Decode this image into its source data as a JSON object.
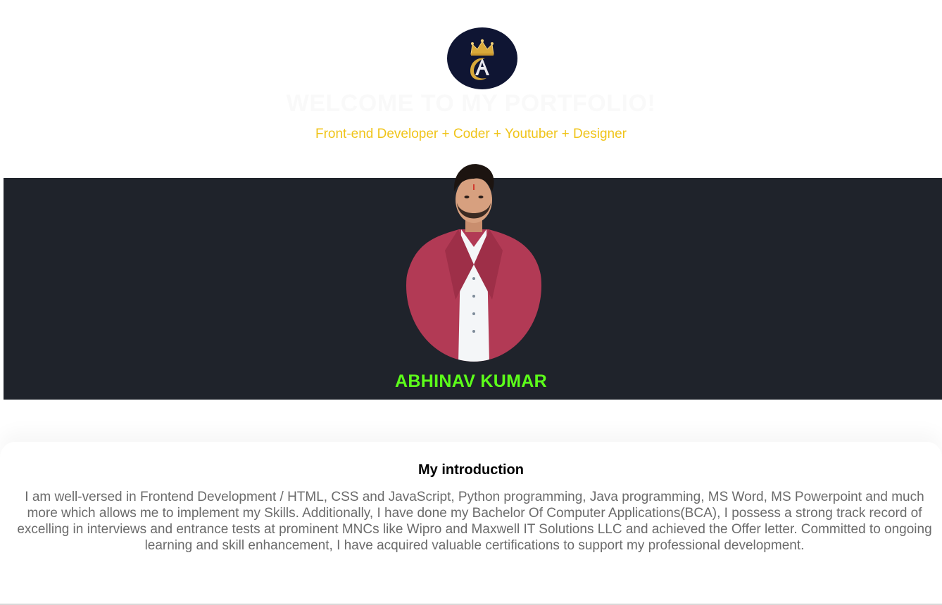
{
  "header": {
    "logo_icon": "crown-letter-a-logo",
    "logo_bg": "#0f1533",
    "welcome": "WELCOME TO MY PORTFOLIO!",
    "subtitle": "Front-end Developer + Coder + Youtuber + Designer",
    "subtitle_color": "#f0c419"
  },
  "hero": {
    "background": "#1f232b",
    "photo": "profile-photo",
    "name": "ABHINAV KUMAR",
    "name_color": "#5cff1a"
  },
  "intro": {
    "title": "My introduction",
    "body": "I am well-versed in Frontend Development / HTML, CSS and JavaScript, Python programming, Java programming, MS Word, MS Powerpoint and much more which allows me to implement my Skills. Additionally, I have done my Bachelor Of Computer Applications(BCA), I possess a strong track record of excelling in interviews and entrance tests at prominent MNCs like Wipro and Maxwell IT Solutions LLC and achieved the Offer letter. Committed to ongoing learning and skill enhancement, I have acquired valuable certifications to support my professional development."
  }
}
